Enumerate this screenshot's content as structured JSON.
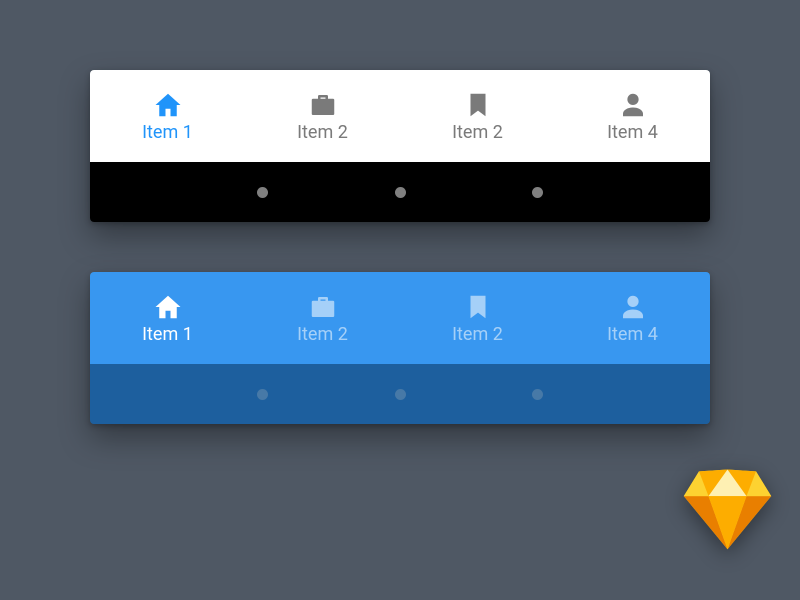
{
  "navbars": {
    "light": {
      "tabs": [
        {
          "label": "Item 1",
          "icon": "house-icon",
          "active": true
        },
        {
          "label": "Item 2",
          "icon": "briefcase-icon",
          "active": false
        },
        {
          "label": "Item 2",
          "icon": "bookmark-icon",
          "active": false
        },
        {
          "label": "Item 4",
          "icon": "person-icon",
          "active": false
        }
      ]
    },
    "blue": {
      "tabs": [
        {
          "label": "Item 1",
          "icon": "house-icon",
          "active": true
        },
        {
          "label": "Item 2",
          "icon": "briefcase-icon",
          "active": false
        },
        {
          "label": "Item 2",
          "icon": "bookmark-icon",
          "active": false
        },
        {
          "label": "Item 4",
          "icon": "person-icon",
          "active": false
        }
      ]
    }
  },
  "colors": {
    "accent": "#2094fa",
    "blueBar": "#3897f0",
    "blueBarDark": "#1d5f9e",
    "inactiveGray": "#7a7a7a",
    "pageBg": "#4f5864"
  }
}
